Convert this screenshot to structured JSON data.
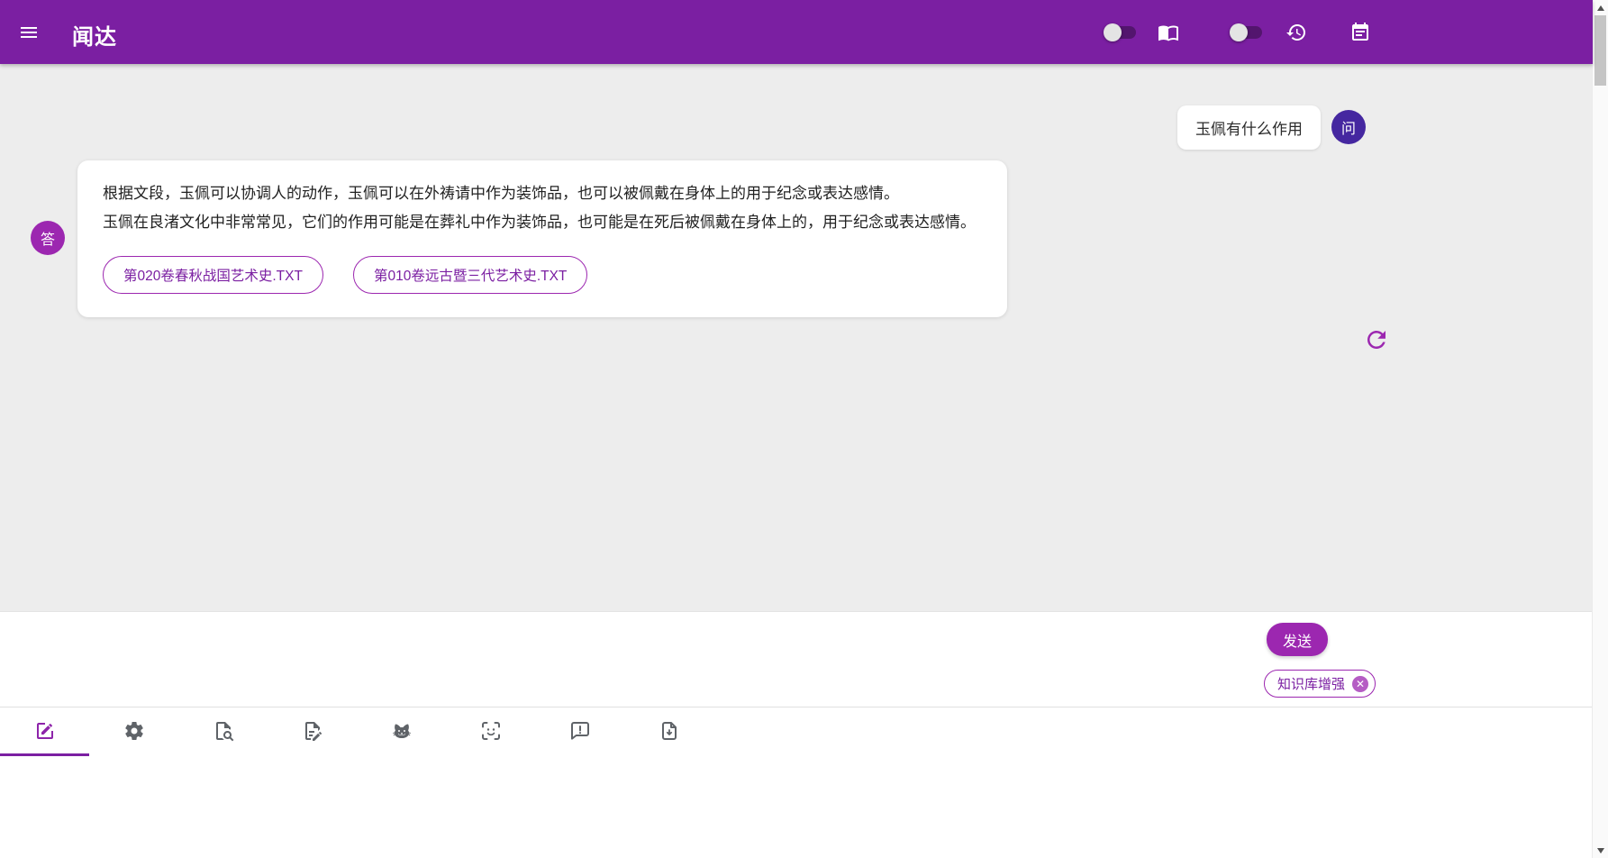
{
  "header": {
    "title": "闻达",
    "controls": {
      "menu_icon": "menu-icon",
      "switch_1_state": "off",
      "book_icon": "book-icon",
      "switch_2_state": "off",
      "history_icon": "history-icon",
      "agenda_icon": "agenda-icon"
    }
  },
  "chat": {
    "question": {
      "avatar": "问",
      "text": "玉佩有什么作用"
    },
    "answer": {
      "avatar": "答",
      "lines": [
        "根据文段，玉佩可以协调人的动作，玉佩可以在外祷请中作为装饰品，也可以被佩戴在身体上的用于纪念或表达感情。",
        "玉佩在良渚文化中非常常见，它们的作用可能是在葬礼中作为装饰品，也可能是在死后被佩戴在身体上的，用于纪念或表达感情。"
      ],
      "sources": [
        "第020卷春秋战国艺术史.TXT",
        "第010卷远古暨三代艺术史.TXT"
      ]
    },
    "refresh_icon": "refresh-icon"
  },
  "composer": {
    "send_label": "发送",
    "chip_label": "知识库增强",
    "chip_close_glyph": "✕"
  },
  "toolbar": {
    "active_index": 0,
    "tabs": [
      "edit-square-icon",
      "settings-gear-icon",
      "file-search-icon",
      "file-edit-icon",
      "cat-icon",
      "face-scan-icon",
      "chat-alert-icon",
      "file-download-icon"
    ]
  },
  "colors": {
    "header": "#7B1FA2",
    "accent": "#9C27B0",
    "question_avatar": "#4527A0",
    "answer_avatar": "#9C27B0",
    "chat_background": "#EDEDED"
  }
}
